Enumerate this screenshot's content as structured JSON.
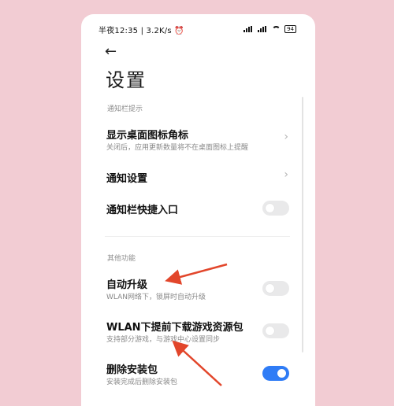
{
  "status_bar": {
    "left_text": "半夜12:35 | 3.2K/s",
    "alarm_icon": "alarm-clock-icon",
    "battery": "94"
  },
  "header": {
    "back_icon": "back-arrow-icon",
    "title": "设置"
  },
  "sections": [
    {
      "label": "通知栏提示",
      "items": [
        {
          "title": "显示桌面图标角标",
          "subtitle": "关闭后，应用更新数量将不在桌面图标上提醒",
          "control": "chevron"
        },
        {
          "title": "通知设置",
          "control": "chevron"
        },
        {
          "title": "通知栏快捷入口",
          "control": "toggle",
          "on": false
        }
      ]
    },
    {
      "label": "其他功能",
      "items": [
        {
          "title": "自动升级",
          "subtitle": "WLAN网络下，锁屏时自动升级",
          "control": "toggle",
          "on": false
        },
        {
          "title": "WLAN下提前下载游戏资源包",
          "subtitle": "支持部分游戏，与游戏中心设置同步",
          "control": "toggle",
          "on": false
        },
        {
          "title": "删除安装包",
          "subtitle": "安装完成后删除安装包",
          "control": "toggle",
          "on": true
        }
      ]
    }
  ],
  "colors": {
    "background": "#f2ccd3",
    "toggle_on": "#2f7cf6",
    "annotation_arrow": "#e2462b"
  }
}
